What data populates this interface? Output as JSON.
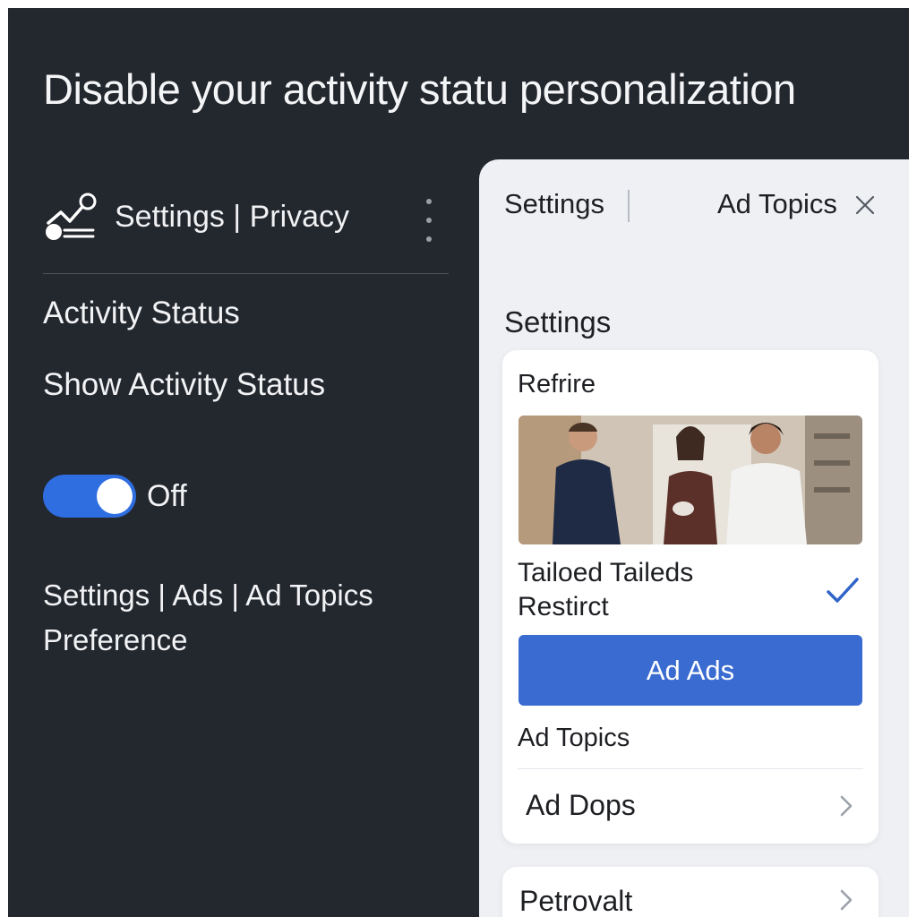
{
  "headline": "Disable your activity statu personalization",
  "left": {
    "breadcrumb": "Settings | Privacy",
    "section_title": "Activity Status",
    "row_label": "Show Activity Status",
    "toggle": {
      "label": "Off",
      "on": true
    },
    "path": "Settings | Ads | Ad Topics Preference"
  },
  "right": {
    "tabs": {
      "settings": "Settings",
      "ad_topics": "Ad Topics"
    },
    "heading": "Settings",
    "card": {
      "title": "Refrire",
      "option_label": "Tailoed Taileds Restirct",
      "option_checked": true,
      "button_label": "Ad Ads",
      "sub_label": "Ad Topics",
      "nav_item": "Ad Dops"
    },
    "card2_item": "Petrovalt"
  },
  "colors": {
    "dark_bg": "#23272e",
    "light_panel": "#eef0f4",
    "accent": "#3a6bd0",
    "toggle": "#2f6ee0"
  },
  "icons": [
    "activity-logo-icon",
    "kebab-menu-icon",
    "close-icon",
    "checkmark-icon",
    "chevron-right-icon"
  ]
}
